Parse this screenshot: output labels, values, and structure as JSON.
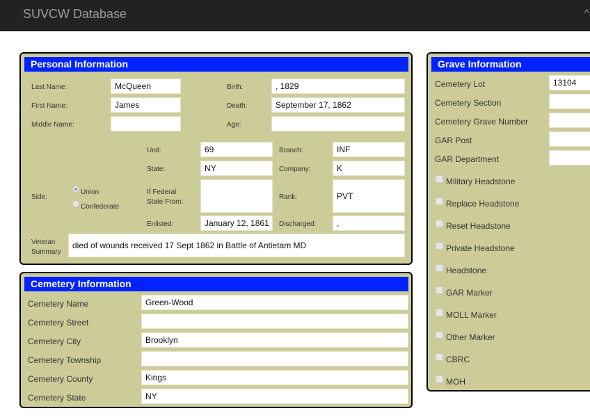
{
  "app": {
    "title": "SUVCW Database",
    "caret": "^"
  },
  "personal": {
    "header": "Personal Information",
    "last_name_label": "Last Name:",
    "last_name": "McQueen",
    "first_name_label": "First Name:",
    "first_name": "James",
    "middle_name_label": "Middle Name:",
    "middle_name": "",
    "birth_label": "Birth:",
    "birth": ", 1829",
    "death_label": "Death:",
    "death": "September 17, 1862",
    "age_label": "Age:",
    "age": "",
    "unit_label": "Unit:",
    "unit": "69",
    "branch_label": "Branch:",
    "branch": "INF",
    "state_label": "State:",
    "state": "NY",
    "company_label": "Company:",
    "company": "K",
    "side_label": "Side:",
    "side_options": [
      "Union",
      "Confederate"
    ],
    "side_selected": "Union",
    "if_federal_label_1": "If Federal",
    "if_federal_label_2": "State From:",
    "if_federal": "",
    "rank_label": "Rank:",
    "rank": "PVT",
    "enlisted_label": "Enlisted:",
    "enlisted": "January 12, 1861",
    "discharged_label": "Discharged:",
    "discharged": ",",
    "veteran_label_1": "Veteran",
    "veteran_label_2": "Summary",
    "veteran_summary": "died of wounds received 17 Sept 1862 in Battle of Antietam MD"
  },
  "cemetery": {
    "header": "Cemetery Information",
    "rows": [
      {
        "label": "Cemetery Name",
        "value": "Green-Wood"
      },
      {
        "label": "Cemetery Street",
        "value": ""
      },
      {
        "label": "Cemetery City",
        "value": "Brooklyn"
      },
      {
        "label": "Cemetery Township",
        "value": ""
      },
      {
        "label": "Cemetery County",
        "value": "Kings"
      },
      {
        "label": "Cemetery State",
        "value": "NY"
      }
    ]
  },
  "grave": {
    "header": "Grave Information",
    "fields": [
      {
        "label": "Cemetery Lot",
        "value": "13104"
      },
      {
        "label": "Cemetery Section",
        "value": ""
      },
      {
        "label": "Cemetery Grave Number",
        "value": ""
      },
      {
        "label": "GAR Post",
        "value": ""
      },
      {
        "label": "GAR Department",
        "value": ""
      }
    ],
    "checkboxes": [
      "Military Headstone",
      "Replace Headstone",
      "Reset Headstone",
      "Private Headstone",
      "Headstone",
      "GAR Marker",
      "MOLL Marker",
      "Other Marker",
      "CBRC",
      "MOH"
    ]
  }
}
